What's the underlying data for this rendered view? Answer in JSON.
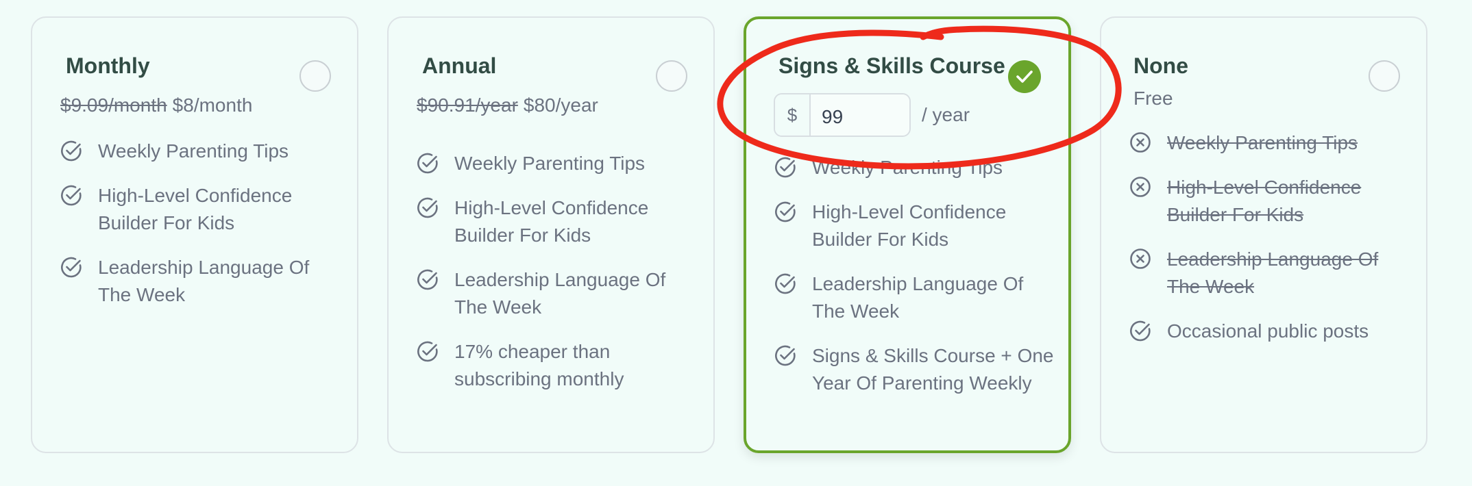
{
  "plans": [
    {
      "title": "Monthly",
      "price_old": "$9.09/month",
      "price_new": "$8/month",
      "selected": false,
      "features": [
        {
          "text": "Weekly Parenting Tips",
          "included": true
        },
        {
          "text": "High-Level Confidence Builder For Kids",
          "included": true
        },
        {
          "text": "Leadership Language Of The Week",
          "included": true
        }
      ]
    },
    {
      "title": "Annual",
      "price_old": "$90.91/year",
      "price_new": "$80/year",
      "selected": false,
      "features": [
        {
          "text": "Weekly Parenting Tips",
          "included": true
        },
        {
          "text": "High-Level Confidence Builder For Kids",
          "included": true
        },
        {
          "text": "Leadership Language Of The Week",
          "included": true
        },
        {
          "text": "17% cheaper than subscribing monthly",
          "included": true
        }
      ]
    },
    {
      "title": "Signs & Skills Course",
      "currency_symbol": "$",
      "amount_value": "99",
      "period_label": "/ year",
      "selected": true,
      "features": [
        {
          "text": "Weekly Parenting Tips",
          "included": true
        },
        {
          "text": "High-Level Confidence Builder For Kids",
          "included": true
        },
        {
          "text": "Leadership Language Of The Week",
          "included": true
        },
        {
          "text": "Signs & Skills Course + One Year Of Parenting Weekly",
          "included": true
        }
      ]
    },
    {
      "title": "None",
      "price_label": "Free",
      "selected": false,
      "features": [
        {
          "text": "Weekly Parenting Tips",
          "included": false
        },
        {
          "text": "High-Level Confidence Builder For Kids",
          "included": false
        },
        {
          "text": "Leadership Language Of The Week",
          "included": false
        },
        {
          "text": "Occasional public posts",
          "included": true
        }
      ]
    }
  ],
  "icons": {
    "included": "check-circle-icon",
    "excluded": "x-circle-icon",
    "selected": "check-icon"
  },
  "colors": {
    "accent": "#6aa52c",
    "title": "#324c45",
    "text": "#6b7280",
    "annotation": "#ee2a1b",
    "background": "#f1fcf9"
  }
}
